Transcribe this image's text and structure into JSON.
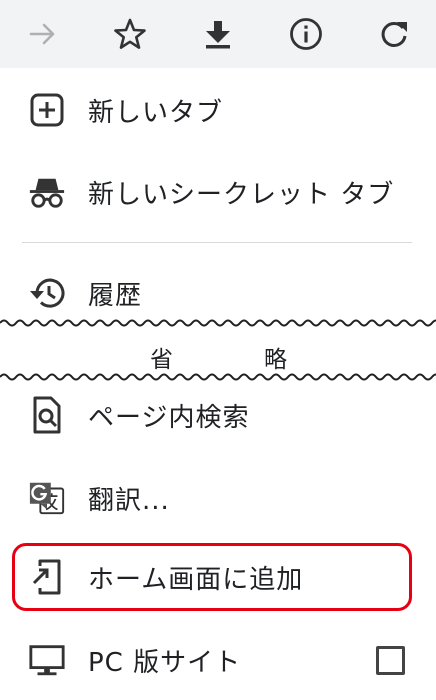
{
  "toolbar": {
    "buttons": [
      {
        "icon": "forward-arrow-icon",
        "enabled": false
      },
      {
        "icon": "star-icon",
        "enabled": true
      },
      {
        "icon": "download-icon",
        "enabled": true
      },
      {
        "icon": "info-icon",
        "enabled": true
      },
      {
        "icon": "reload-icon",
        "enabled": true
      }
    ]
  },
  "menu": {
    "new_tab": "新しいタブ",
    "new_incognito_tab": "新しいシークレット タブ",
    "history": "履歴",
    "omitted_left": "省",
    "omitted_right": "略",
    "find_in_page": "ページ内検索",
    "translate": "翻訳...",
    "add_to_home": "ホーム画面に追加",
    "desktop_site": "PC 版サイト"
  },
  "desktop_site_checked": false,
  "colors": {
    "toolbar_bg": "#f1f3f4",
    "icon": "#333333",
    "highlight": "#e60012",
    "text": "#202124"
  }
}
